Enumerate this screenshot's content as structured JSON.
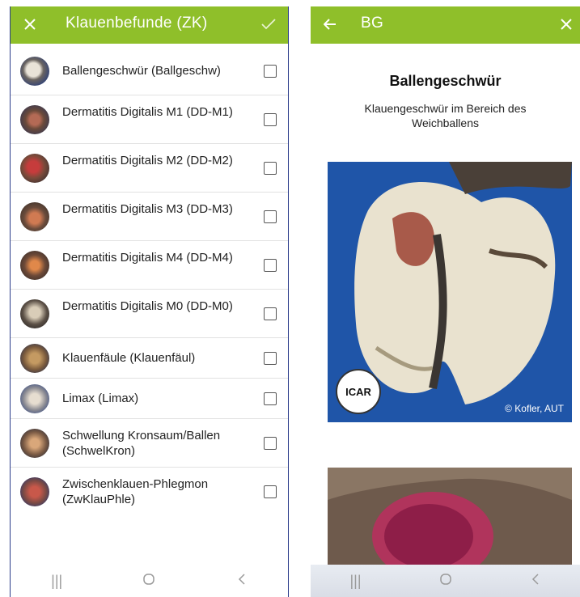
{
  "left": {
    "title": "Klauenbefunde (ZK)",
    "items": [
      {
        "label": "Ballengeschwür (Ballgeschw)"
      },
      {
        "label": "Dermatitis Digitalis M1 (DD-M1)"
      },
      {
        "label": "Dermatitis Digitalis M2 (DD-M2)"
      },
      {
        "label": "Dermatitis Digitalis M3 (DD-M3)"
      },
      {
        "label": "Dermatitis Digitalis M4 (DD-M4)"
      },
      {
        "label": "Dermatitis Digitalis M0 (DD-M0)"
      },
      {
        "label": "Klauenfäule (Klauenfäul)"
      },
      {
        "label": "Limax (Limax)"
      },
      {
        "label": "Schwellung Kronsaum/Ballen (SchwelKron)"
      },
      {
        "label": "Zwischenklauen-Phlegmon (ZwKlauPhle)"
      }
    ]
  },
  "right": {
    "title": "BG",
    "heading": "Ballengeschwür",
    "subtitle": "Klauengeschwür im Bereich des Weichballens",
    "photo_credit": "© Kofler, AUT",
    "logo_text": "ICAR"
  },
  "colors": {
    "appbar": "#8fbf2a",
    "photo_bg": "#1f55a8"
  },
  "icons": {
    "close": "close-icon",
    "check": "check-icon",
    "back": "back-arrow-icon",
    "nav_recents": "recents-icon",
    "nav_home": "home-icon",
    "nav_back": "nav-back-icon"
  }
}
